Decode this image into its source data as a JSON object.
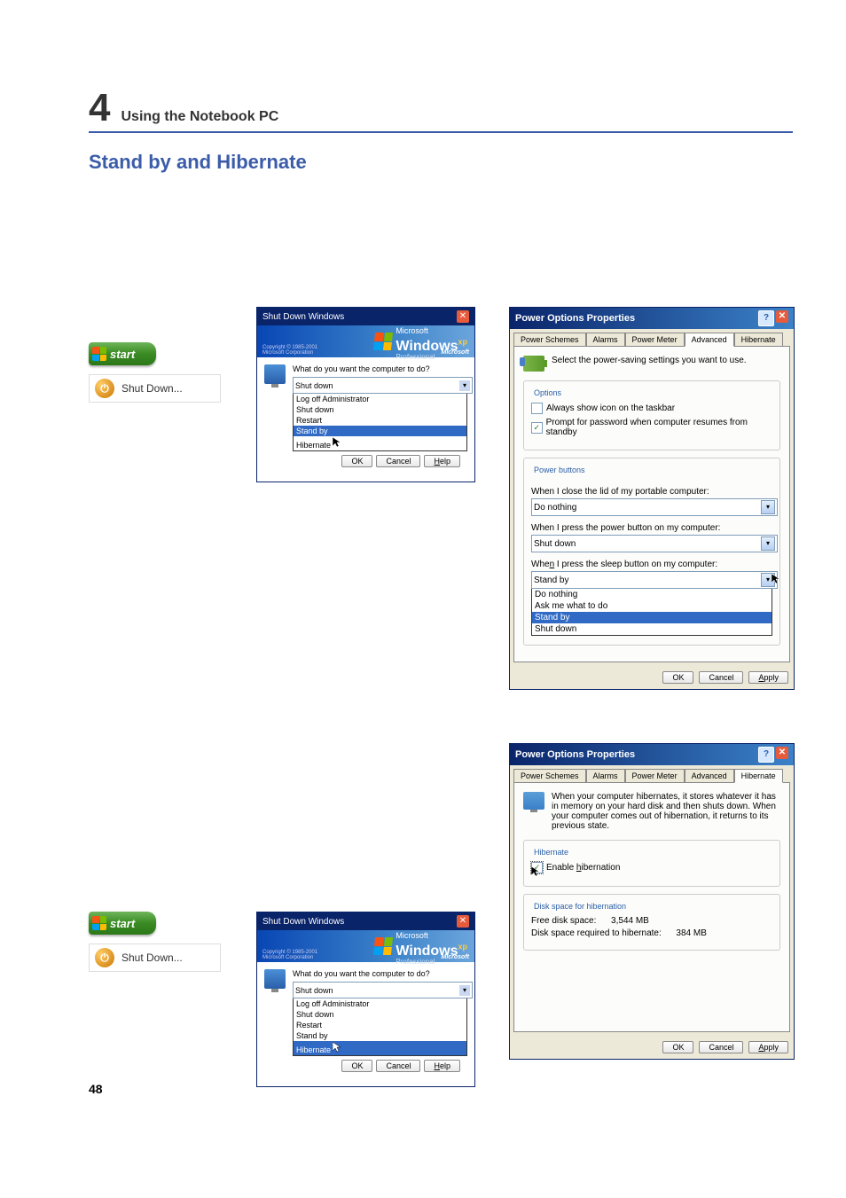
{
  "chapter": {
    "number": "4",
    "title": "Using the Notebook PC"
  },
  "section_title": "Stand by and Hibernate",
  "page_number": "48",
  "start_button": {
    "label": "start"
  },
  "shutdown_menu_item": {
    "label": "Shut Down..."
  },
  "shutdown_dialog": {
    "title": "Shut Down Windows",
    "logo_main": "Windows",
    "logo_xp": "xp",
    "logo_sub": "Professional",
    "copyright": "Copyright © 1985-2001",
    "corp": "Microsoft Corporation",
    "microsoft": "Microsoft",
    "question": "What do you want the computer to do?",
    "selected": "Shut down",
    "options": [
      "Log off Administrator",
      "Shut down",
      "Restart",
      "Stand by",
      "Hibernate"
    ],
    "btn_ok": "OK",
    "btn_cancel": "Cancel",
    "btn_help": "Help"
  },
  "shutdown_dialog_1": {
    "highlighted": "Stand by"
  },
  "shutdown_dialog_2": {
    "highlighted": "Hibernate"
  },
  "pop_advanced": {
    "title": "Power Options Properties",
    "tabs": [
      "Power Schemes",
      "Alarms",
      "Power Meter",
      "Advanced",
      "Hibernate"
    ],
    "active_tab": "Advanced",
    "intro": "Select the power-saving settings you want to use.",
    "options_title": "Options",
    "chk1": {
      "checked": false,
      "label": "Always show icon on the taskbar"
    },
    "chk2": {
      "checked": true,
      "label": "Prompt for password when computer resumes from standby"
    },
    "power_buttons_title": "Power buttons",
    "lbl_close_lid": "When I close the lid of my portable computer:",
    "val_close_lid": "Do nothing",
    "lbl_power_btn": "When I press the power button on my computer:",
    "val_power_btn": "Shut down",
    "lbl_sleep_btn": "When I press the sleep button on my computer:",
    "val_sleep_btn": "Stand by",
    "sleep_options": [
      "Do nothing",
      "Ask me what to do",
      "Stand by",
      "Shut down"
    ],
    "sleep_highlighted": "Stand by",
    "btn_ok": "OK",
    "btn_cancel": "Cancel",
    "btn_apply": "Apply"
  },
  "pop_hibernate": {
    "title": "Power Options Properties",
    "tabs": [
      "Power Schemes",
      "Alarms",
      "Power Meter",
      "Advanced",
      "Hibernate"
    ],
    "active_tab": "Hibernate",
    "intro": "When your computer hibernates, it stores whatever it has in memory on your hard disk and then shuts down. When your computer comes out of hibernation, it returns to its previous state.",
    "hibernate_title": "Hibernate",
    "chk_enable": {
      "checked": true,
      "label": "Enable hibernation"
    },
    "disk_title": "Disk space for hibernation",
    "free_label": "Free disk space:",
    "free_value": "3,544 MB",
    "req_label": "Disk space required to hibernate:",
    "req_value": "384 MB",
    "btn_ok": "OK",
    "btn_cancel": "Cancel",
    "btn_apply": "Apply"
  }
}
